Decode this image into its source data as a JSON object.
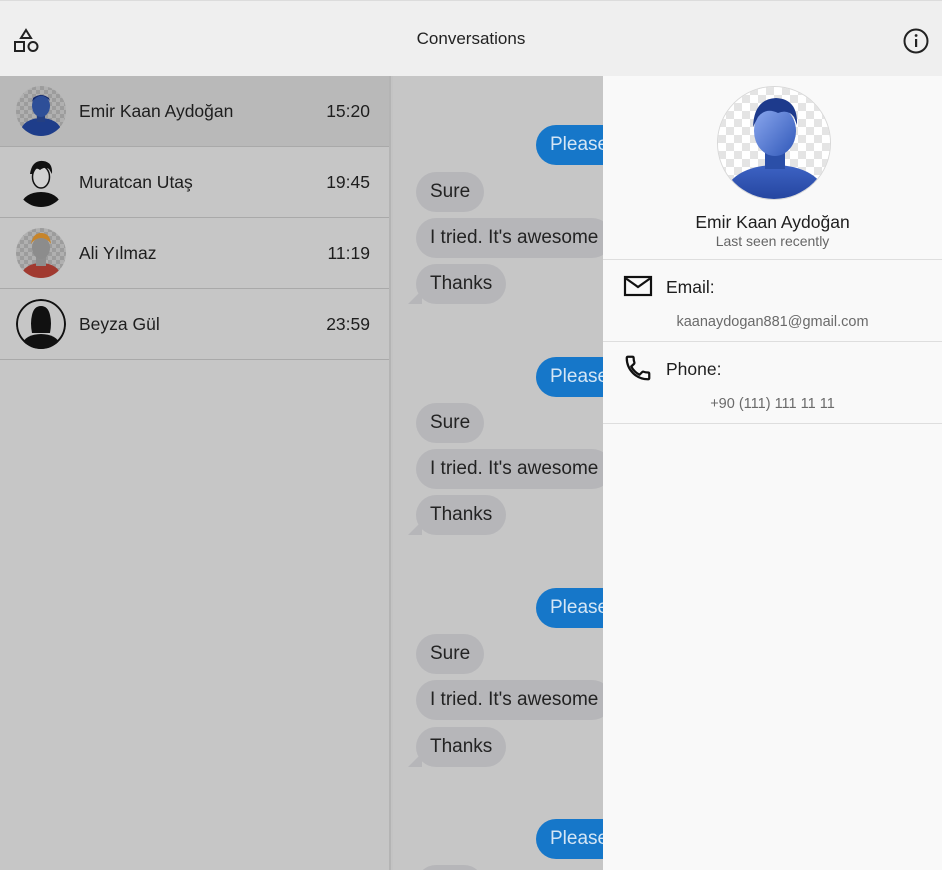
{
  "appbar": {
    "title": "Conversations",
    "left_icon": "shapes-icon",
    "right_icon": "info-icon"
  },
  "conversations": [
    {
      "name": "Emir Kaan Aydoğan",
      "time": "15:20",
      "avatar": "avatar-blue-person",
      "selected": true
    },
    {
      "name": "Muratcan Utaş",
      "time": "19:45",
      "avatar": "avatar-black-hair"
    },
    {
      "name": "Ali Yılmaz",
      "time": "11:19",
      "avatar": "avatar-orange-hair"
    },
    {
      "name": "Beyza Gül",
      "time": "23:59",
      "avatar": "avatar-silhouette-female"
    }
  ],
  "chat": {
    "messages": [
      {
        "text": "Please",
        "dir": "out"
      },
      {
        "text": "Sure",
        "dir": "in"
      },
      {
        "text": "I tried. It's awesome",
        "dir": "in"
      },
      {
        "text": "Thanks",
        "dir": "in"
      }
    ]
  },
  "contact": {
    "name": "Emir Kaan Aydoğan",
    "status": "Last seen recently",
    "email_label": "Email:",
    "email": "kaanaydogan881@gmail.com",
    "phone_label": "Phone:",
    "phone": "+90 (111) 111 11 11"
  },
  "colors": {
    "accent": "#1677c9",
    "appbar": "#efefef",
    "drawer": "#f9f9f9"
  }
}
